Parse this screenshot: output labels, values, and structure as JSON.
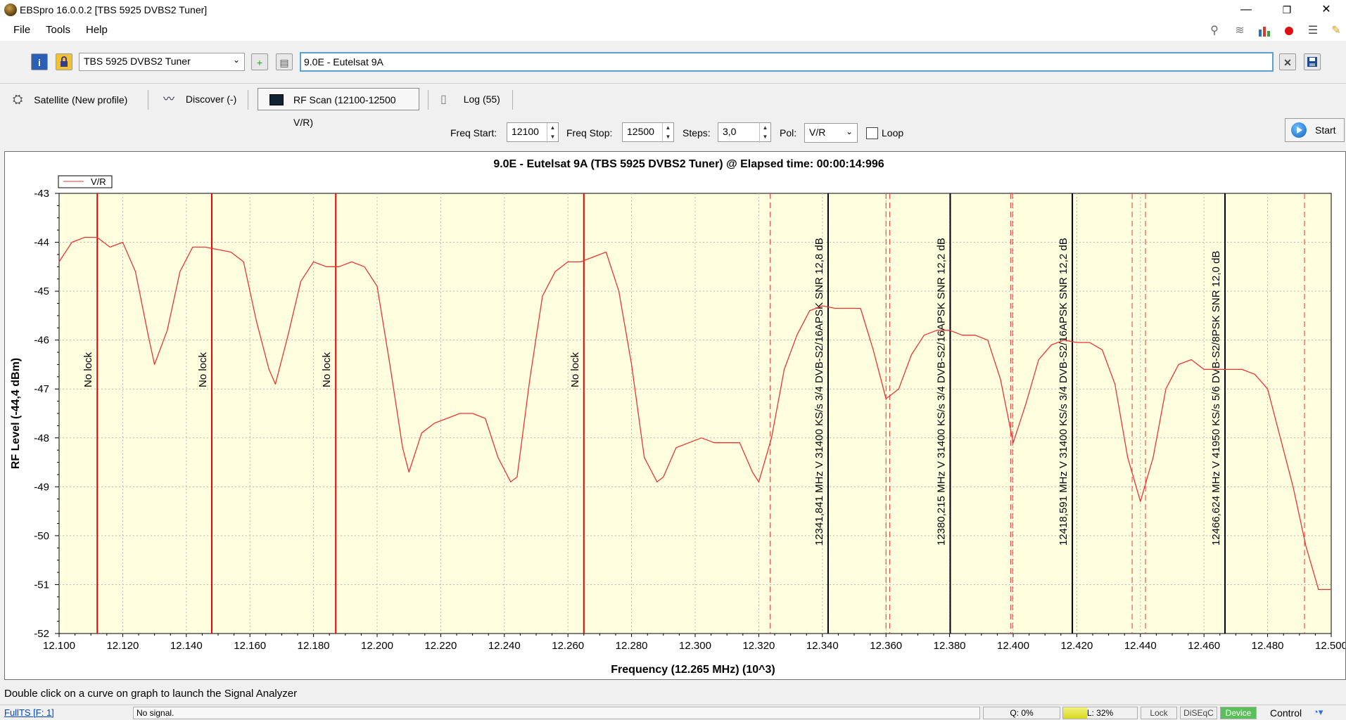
{
  "window": {
    "title": "EBSpro 16.0.0.2 [TBS 5925 DVBS2 Tuner]",
    "minimize": "—",
    "maximize": "❐",
    "close": "✕"
  },
  "menu": [
    "File",
    "Tools",
    "Help"
  ],
  "toolbar_icons": [
    "search-icon",
    "scan-icon",
    "chart-icon",
    "record-icon",
    "list-icon",
    "pin-icon"
  ],
  "toolbar": {
    "tuner": "TBS 5925 DVBS2 Tuner",
    "satellite": "9.0E - Eutelsat 9A"
  },
  "tabs": [
    {
      "label": "Satellite (New profile)",
      "icon": "satellite-icon"
    },
    {
      "label": "Discover (-)",
      "icon": "discover-icon"
    },
    {
      "label": "RF Scan (12100-12500 V/R)",
      "icon": "monitor-icon",
      "active": true
    },
    {
      "label": "Log (55)",
      "icon": "document-icon"
    }
  ],
  "controls": {
    "freq_start_label": "Freq Start:",
    "freq_start": "12100",
    "freq_stop_label": "Freq Stop:",
    "freq_stop": "12500",
    "steps_label": "Steps:",
    "steps": "3,0",
    "pol_label": "Pol:",
    "pol": "V/R",
    "loop_label": "Loop",
    "start_label": "Start"
  },
  "chart_data": {
    "type": "line",
    "title": "9.0E - Eutelsat 9A (TBS 5925 DVBS2 Tuner) @ Elapsed time: 00:00:14:996",
    "xlabel": "Frequency (12.265 MHz) (10^3)",
    "ylabel": "RF Level (-44,4 dBm)",
    "xlim": [
      12.1,
      12.5
    ],
    "ylim": [
      -52,
      -43
    ],
    "x_ticks": [
      "12.100",
      "12.120",
      "12.140",
      "12.160",
      "12.180",
      "12.200",
      "12.220",
      "12.240",
      "12.260",
      "12.280",
      "12.300",
      "12.320",
      "12.340",
      "12.360",
      "12.380",
      "12.400",
      "12.420",
      "12.440",
      "12.460",
      "12.480",
      "12.500"
    ],
    "y_ticks": [
      "-43",
      "-44",
      "-45",
      "-46",
      "-47",
      "-48",
      "-49",
      "-50",
      "-51",
      "-52"
    ],
    "legend": {
      "label": "V/R",
      "placement": "top-left"
    },
    "colors": {
      "line": "#ee3333",
      "background": "#ffffe0",
      "marker_lock": "#000000",
      "marker_nolock": "#ee0000"
    },
    "series": [
      {
        "name": "V/R",
        "x": [
          12.1,
          12.104,
          12.108,
          12.112,
          12.116,
          12.12,
          12.124,
          12.128,
          12.13,
          12.134,
          12.138,
          12.142,
          12.146,
          12.15,
          12.154,
          12.158,
          12.162,
          12.166,
          12.168,
          12.172,
          12.176,
          12.18,
          12.184,
          12.188,
          12.192,
          12.196,
          12.2,
          12.204,
          12.208,
          12.21,
          12.214,
          12.218,
          12.222,
          12.226,
          12.23,
          12.234,
          12.238,
          12.242,
          12.244,
          12.248,
          12.252,
          12.256,
          12.26,
          12.264,
          12.268,
          12.272,
          12.276,
          12.28,
          12.284,
          12.288,
          12.29,
          12.294,
          12.298,
          12.302,
          12.306,
          12.31,
          12.314,
          12.318,
          12.32,
          12.324,
          12.328,
          12.332,
          12.336,
          12.34,
          12.344,
          12.348,
          12.352,
          12.356,
          12.36,
          12.364,
          12.368,
          12.372,
          12.376,
          12.38,
          12.384,
          12.388,
          12.392,
          12.396,
          12.4,
          12.404,
          12.408,
          12.412,
          12.416,
          12.42,
          12.424,
          12.428,
          12.432,
          12.436,
          12.44,
          12.444,
          12.448,
          12.452,
          12.456,
          12.46,
          12.464,
          12.468,
          12.472,
          12.476,
          12.48,
          12.484,
          12.488,
          12.492,
          12.496,
          12.5
        ],
        "y": [
          -44.4,
          -44.0,
          -43.9,
          -43.9,
          -44.1,
          -44.0,
          -44.6,
          -45.9,
          -46.5,
          -45.8,
          -44.6,
          -44.1,
          -44.1,
          -44.15,
          -44.2,
          -44.4,
          -45.6,
          -46.6,
          -46.9,
          -45.9,
          -44.8,
          -44.4,
          -44.5,
          -44.5,
          -44.4,
          -44.5,
          -44.9,
          -46.5,
          -48.2,
          -48.7,
          -47.9,
          -47.7,
          -47.6,
          -47.5,
          -47.5,
          -47.6,
          -48.4,
          -48.9,
          -48.8,
          -46.8,
          -45.1,
          -44.6,
          -44.4,
          -44.4,
          -44.3,
          -44.2,
          -45.0,
          -46.5,
          -48.4,
          -48.9,
          -48.8,
          -48.2,
          -48.1,
          -48.0,
          -48.1,
          -48.1,
          -48.1,
          -48.7,
          -48.9,
          -48.0,
          -46.6,
          -45.9,
          -45.4,
          -45.3,
          -45.35,
          -45.35,
          -45.35,
          -46.2,
          -47.2,
          -47.0,
          -46.3,
          -45.9,
          -45.8,
          -45.8,
          -45.9,
          -45.9,
          -46.0,
          -46.8,
          -48.1,
          -47.3,
          -46.4,
          -46.1,
          -46.0,
          -46.05,
          -46.05,
          -46.2,
          -46.9,
          -48.4,
          -49.3,
          -48.4,
          -47.0,
          -46.5,
          -46.4,
          -46.6,
          -46.6,
          -46.6,
          -46.6,
          -46.7,
          -47.0,
          -48.0,
          -49.0,
          -50.2,
          -51.1,
          -51.1
        ]
      }
    ],
    "markers": [
      {
        "x": 12.112,
        "type": "solid",
        "color": "#ee0000",
        "label": "No lock"
      },
      {
        "x": 12.148,
        "type": "solid",
        "color": "#ee0000",
        "label": "No lock"
      },
      {
        "x": 12.187,
        "type": "solid",
        "color": "#ee0000",
        "label": "No lock"
      },
      {
        "x": 12.265,
        "type": "solid",
        "color": "#ee0000",
        "label": "No lock"
      },
      {
        "x": 12.3418,
        "type": "solid",
        "color": "#000000",
        "label": "12341,841 MHz V 31400 KS/s 3/4 DVB-S2/16APSK SNR 12,8 dB",
        "bounds": [
          12.3236,
          12.36
        ]
      },
      {
        "x": 12.3802,
        "type": "solid",
        "color": "#000000",
        "label": "12380,215 MHz V 31400 KS/s 3/4 DVB-S2/16APSK SNR 12,2 dB",
        "bounds": [
          12.3612,
          12.3992
        ]
      },
      {
        "x": 12.4186,
        "type": "solid",
        "color": "#000000",
        "label": "12418,591 MHz V 31400 KS/s 3/4 DVB-S2/16APSK SNR 12,2 dB",
        "bounds": [
          12.3998,
          12.4374
        ]
      },
      {
        "x": 12.4666,
        "type": "solid",
        "color": "#000000",
        "label": "12466,624 MHz V 41950 KS/s 5/6 DVB-S2/8PSK SNR 12,0 dB",
        "bounds": [
          12.4416,
          12.4916
        ]
      }
    ]
  },
  "hint": "Double click on a curve on graph to launch the Signal Analyzer",
  "statusbar": {
    "fullts": "FullTS [F: 1]",
    "signal": "No signal.",
    "quality": "Q: 0%",
    "level": "L: 32%",
    "level_fraction": 0.32,
    "lock": "Lock",
    "diseqc": "DiSEqC",
    "device": "Device",
    "control": "Control"
  }
}
